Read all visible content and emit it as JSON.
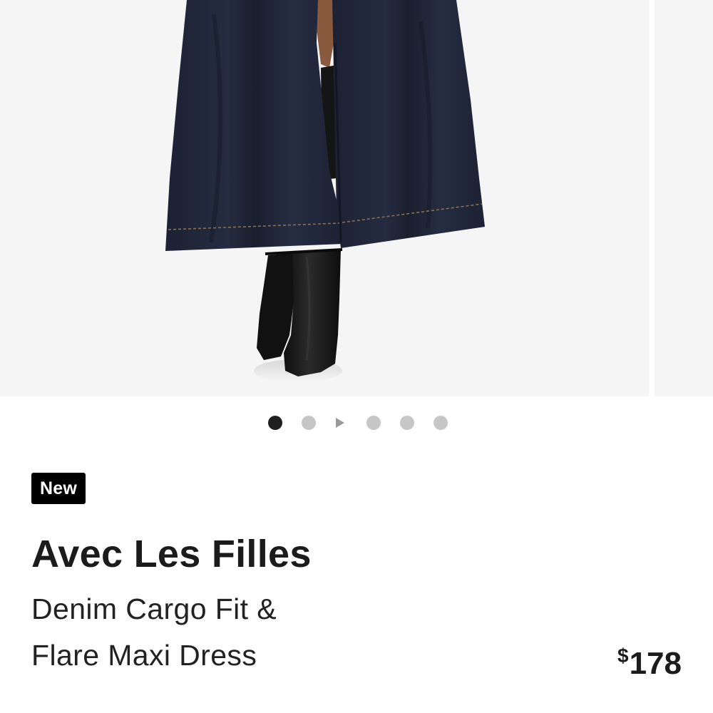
{
  "carousel": {
    "image_alt": "Model wearing a dark indigo denim maxi dress with black boots",
    "slide_count": 6,
    "active_index": 0
  },
  "product": {
    "badge": "New",
    "brand": "Avec Les Filles",
    "name_line1": "Denim Cargo Fit &",
    "name_line2": "Flare Maxi Dress",
    "price_symbol": "$",
    "price_amount": "178"
  },
  "colors": {
    "denim": "#1f2537",
    "boot": "#141414",
    "dot_active": "#1f1f1f",
    "dot_inactive": "#c6c6c6",
    "badge_bg": "#000000"
  },
  "icons": [
    "play-icon"
  ]
}
